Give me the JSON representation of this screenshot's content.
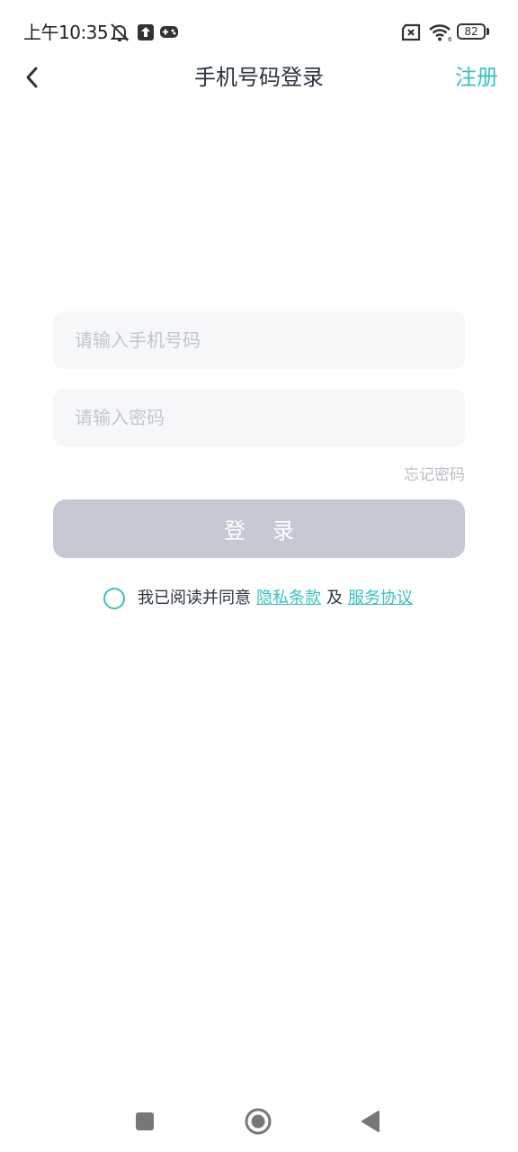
{
  "status_bar": {
    "time": "上午10:35",
    "battery": "82",
    "icons": [
      "mute-bell-icon",
      "upload-icon",
      "gamepad-icon",
      "no-sim-icon",
      "wifi-icon",
      "battery-icon"
    ]
  },
  "header": {
    "title": "手机号码登录",
    "register_label": "注册",
    "back_icon": "chevron-left-icon"
  },
  "form": {
    "phone_placeholder": "请输入手机号码",
    "phone_value": "",
    "password_placeholder": "请输入密码",
    "password_value": "",
    "forgot_label": "忘记密码",
    "login_label": "登录"
  },
  "agreement": {
    "checked": false,
    "prefix": "我已阅读并同意",
    "privacy_label": "隐私条款",
    "joiner": "及",
    "service_label": "服务协议"
  },
  "nav_bar": {
    "icons": [
      "recents-square-icon",
      "home-circle-icon",
      "back-triangle-icon"
    ]
  },
  "colors": {
    "accent": "#3bbfbf",
    "title_text": "#2b3440",
    "input_bg": "#f6f7f9",
    "placeholder": "#c2c6cc",
    "button_disabled": "#c4c9d3"
  }
}
